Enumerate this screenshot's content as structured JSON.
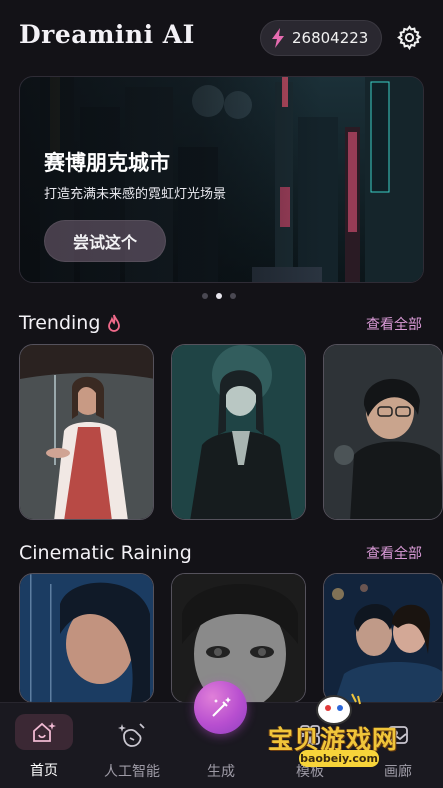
{
  "header": {
    "app_title": "Dreamini AI",
    "credits": "26804223",
    "settings_icon": "gear-icon",
    "credits_icon": "lightning-icon"
  },
  "banner": {
    "title": "赛博朋克城市",
    "subtitle": "打造充满未来感的霓虹灯光场景",
    "button": "尝试这个",
    "slide_count": 3,
    "active_slide": 2
  },
  "sections": [
    {
      "title": "Trending",
      "icon": "fire-icon",
      "see_all": "查看全部"
    },
    {
      "title": "Cinematic Raining",
      "see_all": "查看全部"
    }
  ],
  "nav": {
    "items": [
      {
        "label": "首页",
        "icon": "home-sparkle-icon",
        "active": true
      },
      {
        "label": "人工智能",
        "icon": "ai-magic-icon",
        "active": false
      },
      {
        "label": "生成",
        "icon": "magic-wand-icon",
        "active": false
      },
      {
        "label": "模板",
        "icon": "template-icon",
        "active": false
      },
      {
        "label": "画廊",
        "icon": "gallery-icon",
        "active": false
      }
    ]
  },
  "watermark": {
    "text": "宝贝游戏网",
    "url": "baobeiy.com"
  },
  "colors": {
    "background": "#131217",
    "accent_pink": "#d99ad6",
    "fab": "#b84fd0",
    "credits_bolt": "#e66bb0"
  }
}
